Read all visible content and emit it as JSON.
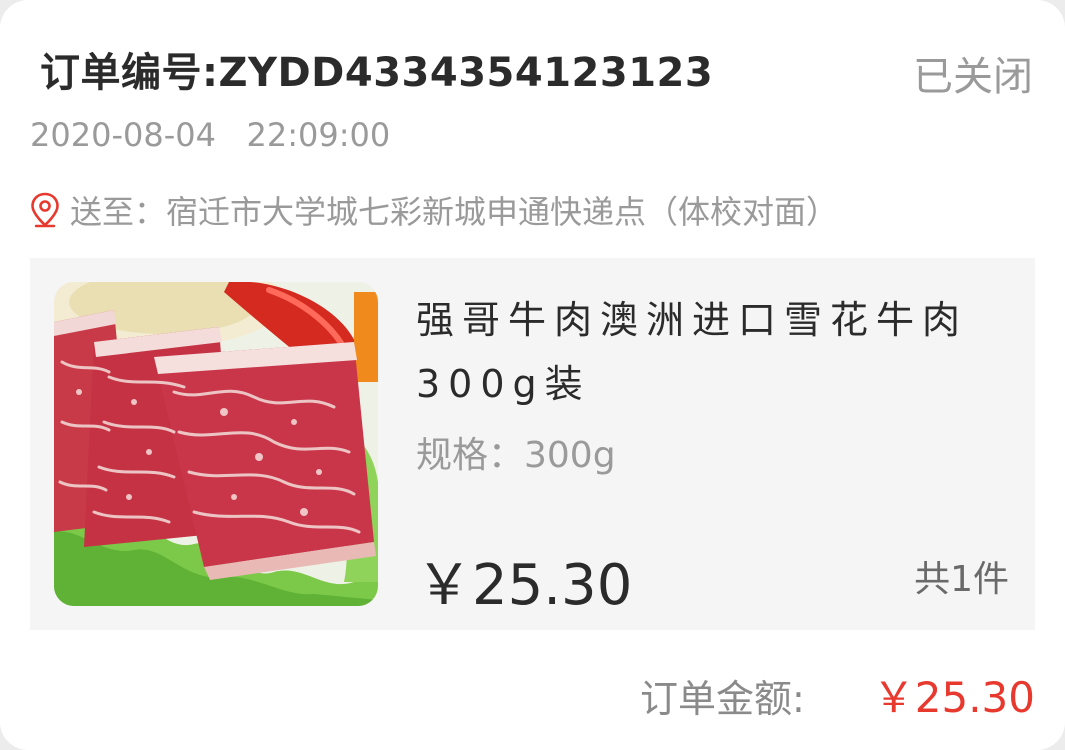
{
  "order": {
    "number_label": "订单编号:",
    "number": "ZYDD4334354123123",
    "status": "已关闭",
    "datetime": "2020-08-04   22:09:00",
    "address_prefix": "送至：",
    "address": "宿迁市大学城七彩新城申通快递点（体校对面）"
  },
  "product": {
    "title": "强哥牛肉澳洲进口雪花牛肉300g装",
    "spec": "规格：300g",
    "price": "￥25.30",
    "quantity": "共1件",
    "image": "marbled-beef-image"
  },
  "summary": {
    "total_label": "订单金额:",
    "total_value": "￥25.30"
  },
  "colors": {
    "accent_red": "#e8392f",
    "text_dark": "#2b2b2b",
    "text_gray": "#9a9a9a",
    "panel_bg": "#f5f5f5"
  },
  "icons": {
    "location": "location-pin-icon"
  }
}
